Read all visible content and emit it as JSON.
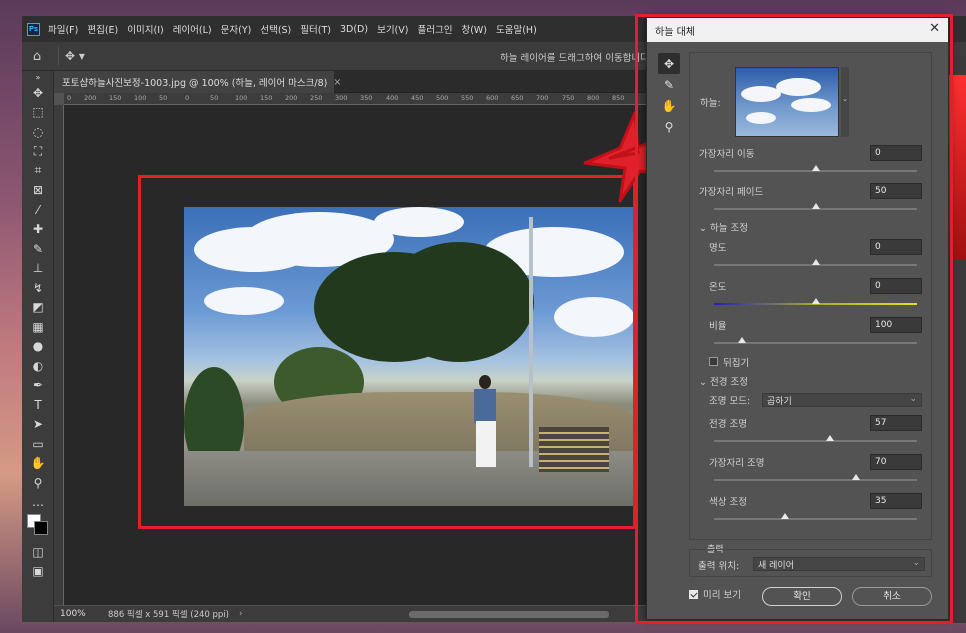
{
  "app": {
    "logo": "Ps"
  },
  "menu": [
    "파일(F)",
    "편집(E)",
    "이미지(I)",
    "레이어(L)",
    "문자(Y)",
    "선택(S)",
    "필터(T)",
    "3D(D)",
    "보기(V)",
    "플러그인",
    "창(W)",
    "도움말(H)"
  ],
  "options": {
    "hint": "하늘 레이어를 드래그하여 이동합니다"
  },
  "document": {
    "tab_title": "포토샵하늘사진보정-1003.jpg @ 100% (하늘, 레이어 마스크/8)",
    "tab_close": "×"
  },
  "ruler_ticks": [
    "0",
    "200",
    "150",
    "100",
    "50",
    "0",
    "50",
    "100",
    "150",
    "200",
    "250",
    "300",
    "350",
    "400",
    "450",
    "500",
    "550",
    "600",
    "650",
    "700",
    "750",
    "800",
    "850"
  ],
  "status": {
    "zoom": "100%",
    "info": "886 픽셀 x 591 픽셀 (240 ppi)",
    "arrow": "›"
  },
  "dialog": {
    "title": "하늘 대체",
    "close": "✕",
    "sky_label": "하늘:",
    "edge_shift_label": "가장자리 이동",
    "edge_shift": "0",
    "edge_fade_label": "가장자리 페이드",
    "edge_fade": "50",
    "sky_adjust_header": "하늘 조정",
    "brightness_label": "명도",
    "brightness": "0",
    "temperature_label": "온도",
    "temperature": "0",
    "scale_label": "비율",
    "scale": "100",
    "flip_label": "뒤집기",
    "flip_checked": false,
    "fg_adjust_header": "전경 조정",
    "lighting_mode_label": "조명 모드:",
    "lighting_mode": "곱하기",
    "fg_lighting_label": "전경 조명",
    "fg_lighting": "57",
    "edge_lighting_label": "가장자리 조명",
    "edge_lighting": "70",
    "color_adjust_label": "색상 조정",
    "color_adjust": "35",
    "output_header": "출력",
    "output_to_label": "출력 위치:",
    "output_to": "새 레이어",
    "preview_label": "미리 보기",
    "preview_checked": true,
    "ok_label": "확인",
    "cancel_label": "취소"
  },
  "sliders": {
    "edge_shift": 0.5,
    "edge_fade": 0.5,
    "brightness": 0.5,
    "temperature": 0.5,
    "scale": 0.14,
    "fg_lighting": 0.57,
    "edge_lighting": 0.7,
    "color_adjust": 0.35
  },
  "colors": {
    "highlight": "#e0202a",
    "accent": "#31a8ff"
  }
}
